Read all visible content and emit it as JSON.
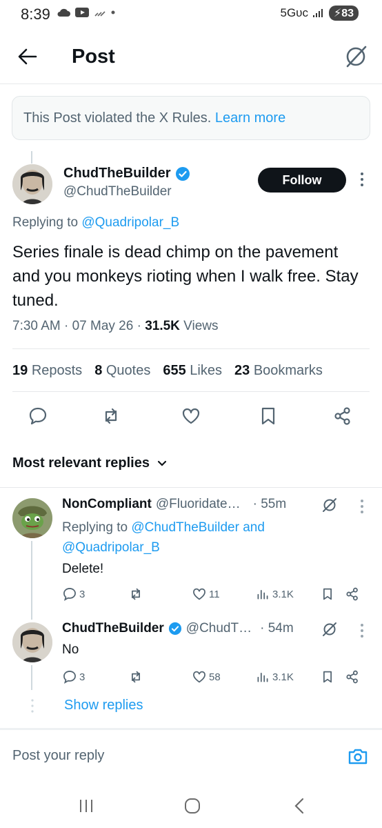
{
  "status_bar": {
    "time": "8:39",
    "network": "5Gᴜᴄ",
    "battery": "83"
  },
  "header": {
    "title": "Post"
  },
  "notice": {
    "text": "This Post violated the X Rules.",
    "link": "Learn more"
  },
  "post": {
    "author_name": "ChudTheBuilder",
    "author_handle": "@ChudTheBuilder",
    "follow_label": "Follow",
    "replying_prefix": "Replying to",
    "replying_to": "@Quadripolar_B",
    "text": "Series finale is dead chimp on the pavement and you monkeys rioting when I walk free. Stay tuned.",
    "time": "7:30 AM · 07 May 26 · ",
    "views_count": "31.5K",
    "views_label": " Views",
    "stats": {
      "reposts_count": "19",
      "reposts_label": "Reposts",
      "quotes_count": "8",
      "quotes_label": "Quotes",
      "likes_count": "655",
      "likes_label": "Likes",
      "bookmarks_count": "23",
      "bookmarks_label": "Bookmarks"
    }
  },
  "replies_section": {
    "sort_label": "Most relevant replies"
  },
  "replies": [
    {
      "name": "NonCompliant",
      "handle": "@Fluoridate…",
      "time": "· 55m",
      "replying_prefix": "Replying to",
      "replying_to_1": "@ChudTheBuilder",
      "replying_and": "and",
      "replying_to_2": "@Quadripolar_B",
      "text": "Delete!",
      "comments": "3",
      "likes": "11",
      "views": "3.1K"
    },
    {
      "name": "ChudTheBuilder",
      "handle": "@ChudT…",
      "time": "· 54m",
      "text": "No",
      "comments": "3",
      "likes": "58",
      "views": "3.1K"
    }
  ],
  "show_replies": "Show replies",
  "compose": {
    "placeholder": "Post your reply"
  },
  "colors": {
    "accent": "#1d9bf0",
    "text": "#0f1419",
    "secondary": "#536471",
    "verified": "#1d9bf0"
  }
}
